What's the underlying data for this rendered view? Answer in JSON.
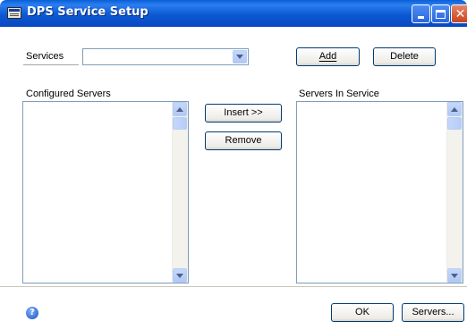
{
  "window": {
    "title": "DPS Service Setup",
    "controls": [
      "minimize-icon",
      "maximize-icon",
      "close-icon"
    ]
  },
  "services": {
    "label": "Services",
    "selected_value": "",
    "add_label": "Add",
    "delete_label": "Delete"
  },
  "configured_servers": {
    "label": "Configured Servers",
    "items": []
  },
  "servers_in_service": {
    "label": "Servers In Service",
    "items": []
  },
  "transfer": {
    "insert_label": "Insert >>",
    "remove_label": "Remove"
  },
  "footer": {
    "help_icon": "help-icon",
    "ok_label": "OK",
    "servers_label": "Servers..."
  },
  "colors": {
    "title_bar": "#0c59d2",
    "window_body": "#ffffff",
    "button_border": "#003c74",
    "field_border": "#7f9db9"
  }
}
